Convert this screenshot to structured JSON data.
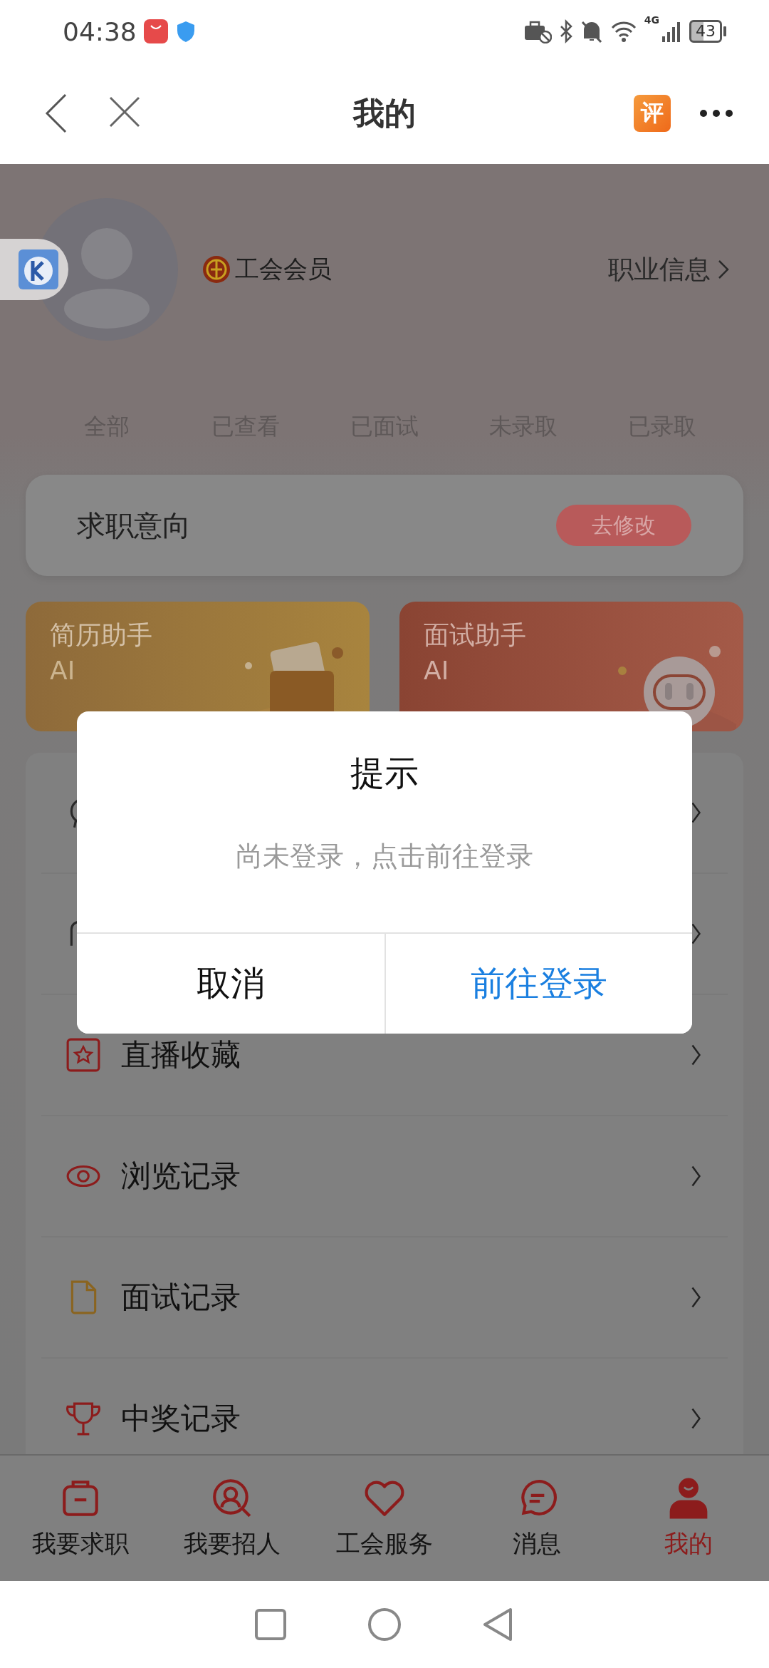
{
  "status_bar": {
    "time": "04:38",
    "network": "4G",
    "battery": "43"
  },
  "header": {
    "title": "我的",
    "review_badge": "评"
  },
  "profile": {
    "badge": "工会会员",
    "link": "职业信息"
  },
  "filter_tabs": [
    {
      "label": "全部"
    },
    {
      "label": "已查看"
    },
    {
      "label": "已面试"
    },
    {
      "label": "未录取"
    },
    {
      "label": "已录取"
    }
  ],
  "intention": {
    "label": "求职意向",
    "button": "去修改"
  },
  "assistants": [
    {
      "title": "简历助手",
      "subtitle": "AI",
      "kind": "resume"
    },
    {
      "title": "面试助手",
      "subtitle": "AI",
      "kind": "interview"
    }
  ],
  "menu": [
    {
      "kind": "chat"
    },
    {
      "kind": "bag"
    },
    {
      "kind": "star",
      "label": "直播收藏"
    },
    {
      "kind": "eye",
      "label": "浏览记录"
    },
    {
      "kind": "file",
      "label": "面试记录"
    },
    {
      "kind": "trophy",
      "label": "中奖记录"
    }
  ],
  "dialog": {
    "title": "提示",
    "message": "尚未登录，点击前往登录",
    "buttons": [
      "取消",
      "前往登录"
    ]
  },
  "bottom_nav": [
    {
      "label": "我要求职",
      "kind": "briefcase",
      "selected": false
    },
    {
      "label": "我要招人",
      "kind": "search-person",
      "selected": false
    },
    {
      "label": "工会服务",
      "kind": "heart",
      "selected": false
    },
    {
      "label": "消息",
      "kind": "chat",
      "selected": false
    },
    {
      "label": "我的",
      "kind": "person",
      "selected": true
    }
  ]
}
